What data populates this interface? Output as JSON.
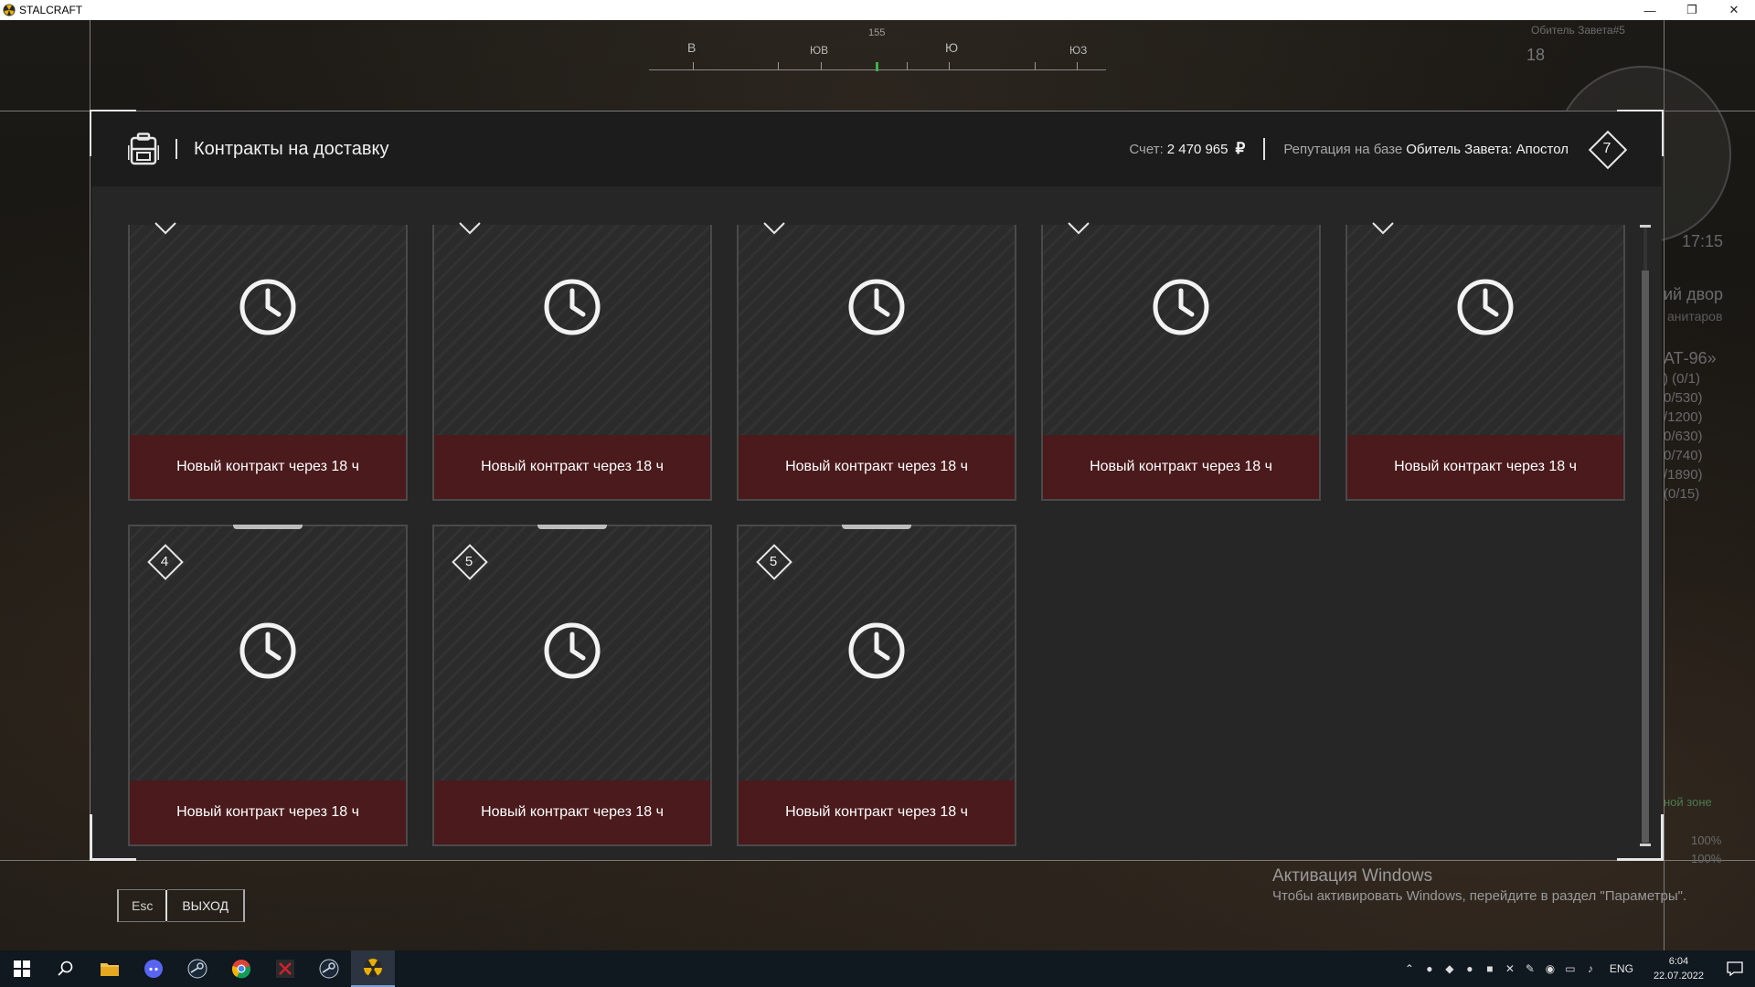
{
  "window": {
    "title": "STALCRAFT",
    "min": "—",
    "max": "❐",
    "close": "✕"
  },
  "compass": {
    "degree": "155",
    "labels": [
      "В",
      "ЮВ",
      "Ю",
      "ЮЗ"
    ]
  },
  "hud": {
    "map_label": "Обитель Завета#5",
    "map_number": "18",
    "time": "17:15",
    "quest_title": "ий двор",
    "quest_sub": "анитаров",
    "quest2": "АТ-96»",
    "progress": [
      ") (0/1)",
      "0/530)",
      "/1200)",
      "0/630)",
      "0/740)",
      "/1890)",
      "(0/15)"
    ],
    "zone": "ной зоне",
    "pct1": "100%",
    "pct2": "100%"
  },
  "dialog": {
    "title": "Контракты на доставку",
    "balance_label": "Счет:",
    "balance_value": "2 470 965",
    "currency": "₽",
    "reputation_label": "Репутация на базе",
    "reputation_value": "Обитель Завета: Апостол",
    "reputation_level": "7"
  },
  "cards_row1": [
    {
      "footer": "Новый контракт через 18 ч"
    },
    {
      "footer": "Новый контракт через 18 ч"
    },
    {
      "footer": "Новый контракт через 18 ч"
    },
    {
      "footer": "Новый контракт через 18 ч"
    },
    {
      "footer": "Новый контракт через 18 ч"
    }
  ],
  "cards_row2": [
    {
      "level": "4",
      "footer": "Новый контракт через 18 ч"
    },
    {
      "level": "5",
      "footer": "Новый контракт через 18 ч"
    },
    {
      "level": "5",
      "footer": "Новый контракт через 18 ч"
    }
  ],
  "escape": {
    "key": "Esc",
    "label": "ВЫХОД"
  },
  "activation": {
    "title": "Активация Windows",
    "text": "Чтобы активировать Windows, перейдите в раздел \"Параметры\"."
  },
  "taskbar": {
    "lang": "ENG",
    "time": "6:04",
    "date": "22.07.2022"
  }
}
